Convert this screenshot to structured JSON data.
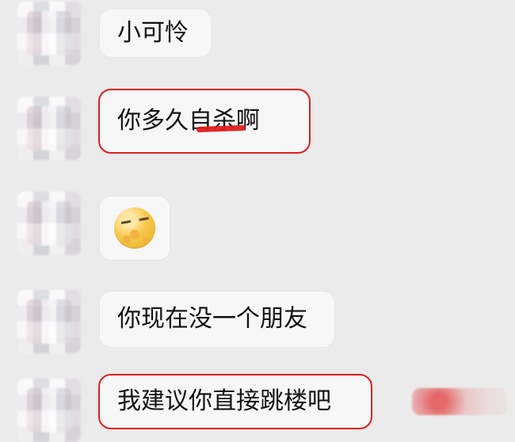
{
  "conversation": {
    "messages": [
      {
        "text": "小可怜"
      },
      {
        "text": "你多久自杀啊"
      },
      {
        "emoji": "smiling-face-with-hand-over-mouth-icon"
      },
      {
        "text": "你现在没一个朋友"
      },
      {
        "text": "我建议你直接跳楼吧"
      }
    ]
  },
  "colors": {
    "background": "#ebebeb",
    "bubble": "#f7f7f7",
    "highlight_border": "#e21c1c",
    "text": "#111111"
  }
}
